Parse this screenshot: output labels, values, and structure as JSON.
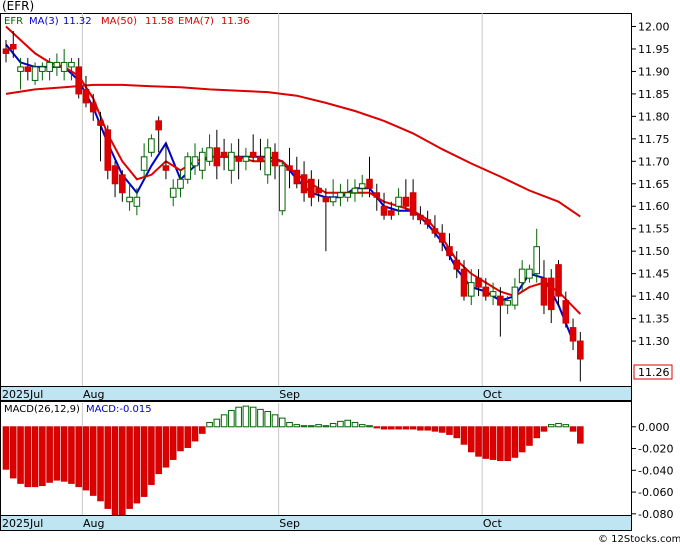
{
  "header": {
    "symbol": "(EFR)"
  },
  "legend": {
    "items": [
      {
        "label": "EFR",
        "color": "#006400"
      },
      {
        "label": "MA(3)",
        "value": "11.32",
        "color": "#0000cc"
      },
      {
        "label": "MA(50)",
        "value": "11.58",
        "color": "#dd0000"
      },
      {
        "label": "EMA(7)",
        "value": "11.36",
        "color": "#dd0000"
      }
    ],
    "macd_label": "MACD(26,12,9)",
    "macd_value_label": "MACD:-0.015"
  },
  "last_price_tag": "11.26",
  "watermark": "© 12Stocks.com",
  "chart_data": [
    {
      "type": "candlestick",
      "title": "(EFR)",
      "x_month_labels": [
        "2025Jul",
        "Aug",
        "Sep",
        "Oct"
      ],
      "ylim": [
        11.2,
        12.03
      ],
      "y_ticks": [
        "12.00",
        "11.95",
        "11.90",
        "11.85",
        "11.80",
        "11.75",
        "11.70",
        "11.65",
        "11.60",
        "11.55",
        "11.50",
        "11.45",
        "11.40",
        "11.35",
        "11.30"
      ],
      "candles": [
        [
          11.95,
          11.97,
          11.92,
          11.94
        ],
        [
          11.96,
          11.99,
          11.93,
          11.95
        ],
        [
          11.9,
          11.93,
          11.86,
          11.91
        ],
        [
          11.91,
          11.93,
          11.88,
          11.9
        ],
        [
          11.88,
          11.92,
          11.87,
          11.91
        ],
        [
          11.9,
          11.92,
          11.88,
          11.91
        ],
        [
          11.9,
          11.93,
          11.88,
          11.92
        ],
        [
          11.91,
          11.94,
          11.89,
          11.92
        ],
        [
          11.9,
          11.95,
          11.88,
          11.92
        ],
        [
          11.91,
          11.93,
          11.88,
          11.92
        ],
        [
          11.91,
          11.93,
          11.84,
          11.85
        ],
        [
          11.86,
          11.89,
          11.82,
          11.83
        ],
        [
          11.83,
          11.85,
          11.79,
          11.81
        ],
        [
          11.79,
          11.81,
          11.7,
          11.78
        ],
        [
          11.77,
          11.78,
          11.66,
          11.68
        ],
        [
          11.69,
          11.7,
          11.62,
          11.65
        ],
        [
          11.67,
          11.68,
          11.61,
          11.63
        ],
        [
          11.61,
          11.65,
          11.59,
          11.62
        ],
        [
          11.6,
          11.64,
          11.58,
          11.62
        ],
        [
          11.68,
          11.74,
          11.66,
          11.71
        ],
        [
          11.72,
          11.76,
          11.71,
          11.75
        ],
        [
          11.79,
          11.8,
          11.72,
          11.77
        ],
        [
          11.69,
          11.74,
          11.66,
          11.68
        ],
        [
          11.62,
          11.66,
          11.6,
          11.64
        ],
        [
          11.64,
          11.68,
          11.62,
          11.66
        ],
        [
          11.66,
          11.72,
          11.65,
          11.71
        ],
        [
          11.69,
          11.74,
          11.67,
          11.71
        ],
        [
          11.68,
          11.73,
          11.66,
          11.72
        ],
        [
          11.7,
          11.76,
          11.69,
          11.73
        ],
        [
          11.73,
          11.77,
          11.66,
          11.69
        ],
        [
          11.72,
          11.75,
          11.68,
          11.71
        ],
        [
          11.68,
          11.74,
          11.65,
          11.72
        ],
        [
          11.71,
          11.75,
          11.66,
          11.7
        ],
        [
          11.7,
          11.73,
          11.68,
          11.71
        ],
        [
          11.72,
          11.76,
          11.7,
          11.71
        ],
        [
          11.71,
          11.75,
          11.68,
          11.7
        ],
        [
          11.67,
          11.75,
          11.65,
          11.73
        ],
        [
          11.72,
          11.74,
          11.66,
          11.69
        ],
        [
          11.59,
          11.7,
          11.58,
          11.69
        ],
        [
          11.69,
          11.73,
          11.64,
          11.68
        ],
        [
          11.68,
          11.71,
          11.64,
          11.65
        ],
        [
          11.67,
          11.7,
          11.61,
          11.63
        ],
        [
          11.66,
          11.68,
          11.6,
          11.62
        ],
        [
          11.64,
          11.66,
          11.61,
          11.63
        ],
        [
          11.62,
          11.64,
          11.5,
          11.61
        ],
        [
          11.61,
          11.66,
          11.6,
          11.62
        ],
        [
          11.62,
          11.65,
          11.6,
          11.63
        ],
        [
          11.62,
          11.66,
          11.61,
          11.63
        ],
        [
          11.63,
          11.66,
          11.61,
          11.64
        ],
        [
          11.64,
          11.67,
          11.62,
          11.65
        ],
        [
          11.66,
          11.71,
          11.62,
          11.64
        ],
        [
          11.63,
          11.65,
          11.59,
          11.62
        ],
        [
          11.6,
          11.63,
          11.57,
          11.58
        ],
        [
          11.59,
          11.61,
          11.57,
          11.58
        ],
        [
          11.6,
          11.64,
          11.58,
          11.62
        ],
        [
          11.62,
          11.66,
          11.59,
          11.6
        ],
        [
          11.63,
          11.66,
          11.57,
          11.58
        ],
        [
          11.58,
          11.6,
          11.56,
          11.57
        ],
        [
          11.57,
          11.59,
          11.55,
          11.56
        ],
        [
          11.55,
          11.58,
          11.53,
          11.54
        ],
        [
          11.54,
          11.56,
          11.5,
          11.52
        ],
        [
          11.51,
          11.54,
          11.48,
          11.49
        ],
        [
          11.48,
          11.5,
          11.44,
          11.46
        ],
        [
          11.46,
          11.48,
          11.39,
          11.4
        ],
        [
          11.4,
          11.46,
          11.38,
          11.43
        ],
        [
          11.44,
          11.46,
          11.4,
          11.42
        ],
        [
          11.42,
          11.44,
          11.39,
          11.4
        ],
        [
          11.4,
          11.43,
          11.38,
          11.41
        ],
        [
          11.4,
          11.42,
          11.31,
          11.38
        ],
        [
          11.38,
          11.4,
          11.36,
          11.39
        ],
        [
          11.38,
          11.44,
          11.37,
          11.42
        ],
        [
          11.43,
          11.48,
          11.41,
          11.46
        ],
        [
          11.44,
          11.47,
          11.43,
          11.46
        ],
        [
          11.45,
          11.55,
          11.43,
          11.51
        ],
        [
          11.44,
          11.48,
          11.36,
          11.38
        ],
        [
          11.44,
          11.46,
          11.34,
          11.37
        ],
        [
          11.47,
          11.48,
          11.38,
          11.4
        ],
        [
          11.39,
          11.41,
          11.33,
          11.34
        ],
        [
          11.33,
          11.35,
          11.28,
          11.3
        ],
        [
          11.3,
          11.32,
          11.21,
          11.26
        ]
      ],
      "series": [
        {
          "name": "MA(3)",
          "color": "#0000cc",
          "values": [
            [
              0,
              11.96
            ],
            [
              2,
              11.92
            ],
            [
              4,
              11.91
            ],
            [
              6,
              11.91
            ],
            [
              8,
              11.91
            ],
            [
              10,
              11.88
            ],
            [
              12,
              11.82
            ],
            [
              14,
              11.74
            ],
            [
              16,
              11.67
            ],
            [
              18,
              11.63
            ],
            [
              20,
              11.69
            ],
            [
              22,
              11.74
            ],
            [
              24,
              11.66
            ],
            [
              26,
              11.69
            ],
            [
              28,
              11.71
            ],
            [
              30,
              11.71
            ],
            [
              32,
              11.71
            ],
            [
              34,
              11.71
            ],
            [
              36,
              11.71
            ],
            [
              38,
              11.7
            ],
            [
              40,
              11.66
            ],
            [
              42,
              11.63
            ],
            [
              44,
              11.62
            ],
            [
              46,
              11.62
            ],
            [
              48,
              11.64
            ],
            [
              50,
              11.64
            ],
            [
              52,
              11.6
            ],
            [
              54,
              11.59
            ],
            [
              56,
              11.59
            ],
            [
              58,
              11.56
            ],
            [
              60,
              11.52
            ],
            [
              62,
              11.46
            ],
            [
              64,
              11.42
            ],
            [
              66,
              11.41
            ],
            [
              68,
              11.39
            ],
            [
              70,
              11.4
            ],
            [
              72,
              11.45
            ],
            [
              74,
              11.44
            ],
            [
              76,
              11.38
            ],
            [
              78,
              11.3
            ]
          ]
        },
        {
          "name": "EMA(7)",
          "color": "#dd0000",
          "values": [
            [
              0,
              12.0
            ],
            [
              2,
              11.97
            ],
            [
              4,
              11.94
            ],
            [
              6,
              11.92
            ],
            [
              8,
              11.91
            ],
            [
              10,
              11.89
            ],
            [
              12,
              11.84
            ],
            [
              14,
              11.76
            ],
            [
              16,
              11.7
            ],
            [
              18,
              11.66
            ],
            [
              20,
              11.67
            ],
            [
              22,
              11.7
            ],
            [
              24,
              11.68
            ],
            [
              26,
              11.7
            ],
            [
              28,
              11.71
            ],
            [
              30,
              11.71
            ],
            [
              32,
              11.71
            ],
            [
              34,
              11.7
            ],
            [
              36,
              11.7
            ],
            [
              38,
              11.7
            ],
            [
              40,
              11.67
            ],
            [
              42,
              11.65
            ],
            [
              44,
              11.63
            ],
            [
              46,
              11.63
            ],
            [
              48,
              11.63
            ],
            [
              50,
              11.63
            ],
            [
              52,
              11.61
            ],
            [
              54,
              11.6
            ],
            [
              56,
              11.59
            ],
            [
              58,
              11.57
            ],
            [
              60,
              11.53
            ],
            [
              62,
              11.48
            ],
            [
              64,
              11.45
            ],
            [
              66,
              11.43
            ],
            [
              68,
              11.41
            ],
            [
              70,
              11.4
            ],
            [
              72,
              11.42
            ],
            [
              74,
              11.43
            ],
            [
              76,
              11.41
            ],
            [
              79,
              11.36
            ]
          ]
        },
        {
          "name": "MA(50)",
          "color": "#dd0000",
          "values": [
            [
              0,
              11.85
            ],
            [
              4,
              11.86
            ],
            [
              8,
              11.865
            ],
            [
              12,
              11.87
            ],
            [
              16,
              11.87
            ],
            [
              20,
              11.867
            ],
            [
              24,
              11.865
            ],
            [
              28,
              11.86
            ],
            [
              32,
              11.857
            ],
            [
              36,
              11.854
            ],
            [
              40,
              11.846
            ],
            [
              44,
              11.83
            ],
            [
              48,
              11.812
            ],
            [
              52,
              11.79
            ],
            [
              56,
              11.762
            ],
            [
              60,
              11.727
            ],
            [
              64,
              11.695
            ],
            [
              68,
              11.666
            ],
            [
              72,
              11.635
            ],
            [
              76,
              11.61
            ],
            [
              79,
              11.577
            ]
          ]
        }
      ]
    },
    {
      "type": "bar",
      "title": "MACD(26,12,9)",
      "ylim": [
        -0.082,
        0.009
      ],
      "y_ticks": [
        "0.000",
        "-0.020",
        "-0.040",
        "-0.060",
        "-0.080"
      ],
      "values": [
        -0.039,
        -0.047,
        -0.052,
        -0.055,
        -0.055,
        -0.054,
        -0.051,
        -0.049,
        -0.05,
        -0.052,
        -0.055,
        -0.058,
        -0.063,
        -0.068,
        -0.075,
        -0.081,
        -0.081,
        -0.075,
        -0.07,
        -0.064,
        -0.053,
        -0.043,
        -0.037,
        -0.03,
        -0.022,
        -0.019,
        -0.013,
        -0.006,
        0.004,
        0.007,
        0.011,
        0.015,
        0.018,
        0.019,
        0.018,
        0.016,
        0.014,
        0.011,
        0.008,
        0.004,
        0.002,
        0.001,
        0.001,
        0.002,
        0.001,
        0.003,
        0.005,
        0.006,
        0.004,
        0.002,
        0.001,
        -0.001,
        -0.002,
        -0.002,
        -0.002,
        -0.002,
        -0.002,
        -0.003,
        -0.003,
        -0.004,
        -0.005,
        -0.007,
        -0.01,
        -0.016,
        -0.023,
        -0.027,
        -0.029,
        -0.03,
        -0.031,
        -0.031,
        -0.028,
        -0.023,
        -0.017,
        -0.01,
        -0.004,
        0.002,
        0.003,
        0.002,
        -0.004,
        -0.015
      ]
    }
  ]
}
